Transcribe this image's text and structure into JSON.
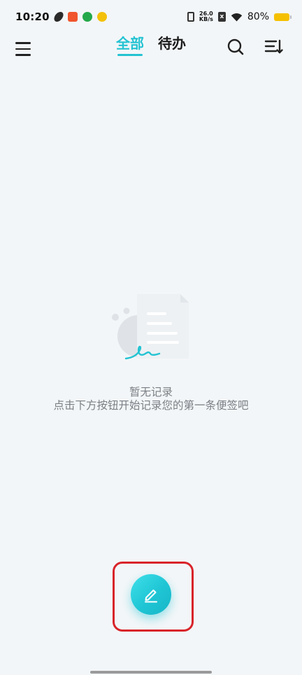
{
  "status_bar": {
    "time": "10:20",
    "net_speed_value": "26.0",
    "net_speed_unit": "KB/s",
    "sim_label": "x",
    "battery_percent": "80%"
  },
  "app_bar": {
    "tabs": [
      {
        "label": "全部",
        "active": true
      },
      {
        "label": "待办",
        "active": false
      }
    ],
    "icons": {
      "menu": "menu-icon",
      "search": "search-icon",
      "sort": "sort-icon"
    },
    "accent_color": "#24c3d2"
  },
  "empty_state": {
    "title": "暂无记录",
    "description": "点击下方按钮开始记录您的第一条便签吧",
    "illustration": "empty-note-icon"
  },
  "fab": {
    "icon": "edit-pencil-icon",
    "highlight_color": "#d8242a"
  }
}
